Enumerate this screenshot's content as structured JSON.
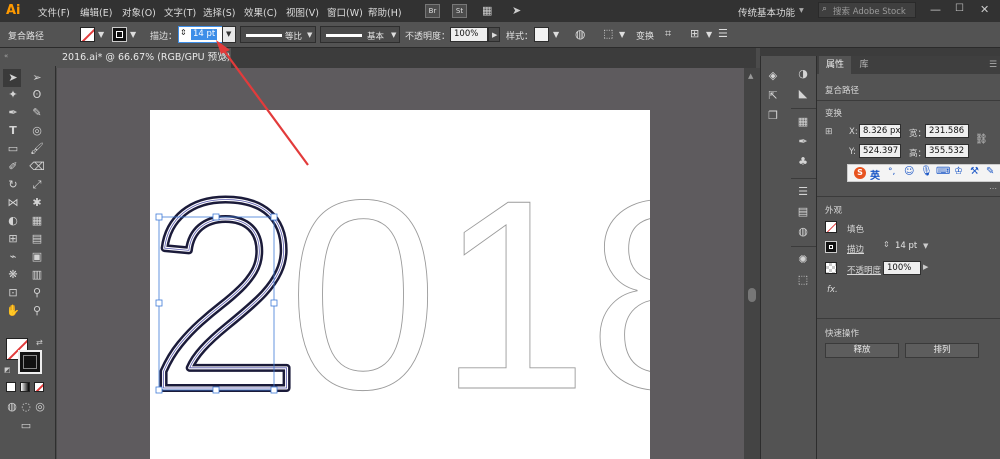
{
  "app": {
    "logo": "Ai"
  },
  "menu": {
    "items": [
      "文件(F)",
      "编辑(E)",
      "对象(O)",
      "文字(T)",
      "选择(S)",
      "效果(C)",
      "视图(V)",
      "窗口(W)",
      "帮助(H)"
    ],
    "bridge": "Br",
    "stock": "St",
    "workspace": "传统基本功能",
    "search_placeholder": "搜索 Adobe Stock"
  },
  "control": {
    "object_type": "复合路径",
    "stroke_label": "描边：",
    "stroke_value": "14 pt",
    "profile_label": "等比",
    "brush_label": "基本",
    "opacity_label": "不透明度：",
    "opacity_value": "100%",
    "style_label": "样式：",
    "transform_label": "变换"
  },
  "document": {
    "tab_title": "2016.ai* @ 66.67% (RGB/GPU 预览)"
  },
  "artwork": {
    "text": "2018",
    "outlined_char": "2",
    "rest": "018"
  },
  "properties": {
    "tab_properties": "属性",
    "tab_library": "库",
    "object_type": "复合路径",
    "transform_title": "变换",
    "x_label": "X:",
    "x_value": "8.326 px",
    "y_label": "Y:",
    "y_value": "524.397",
    "w_label": "宽：",
    "w_value": "231.586",
    "h_label": "高：",
    "h_value": "355.532",
    "ime_label": "英",
    "appearance_title": "外观",
    "fill_label": "填色",
    "stroke_label": "描边",
    "stroke_value": "14 pt",
    "opacity_label": "不透明度",
    "opacity_value": "100%",
    "fx_label": "fx.",
    "quick_actions_title": "快速操作",
    "release_button": "释放",
    "arrange_button": "排列"
  },
  "colors": {
    "accent": "#e23b3b",
    "highlight": "#3d8ee8",
    "brand": "#ff9a00"
  }
}
